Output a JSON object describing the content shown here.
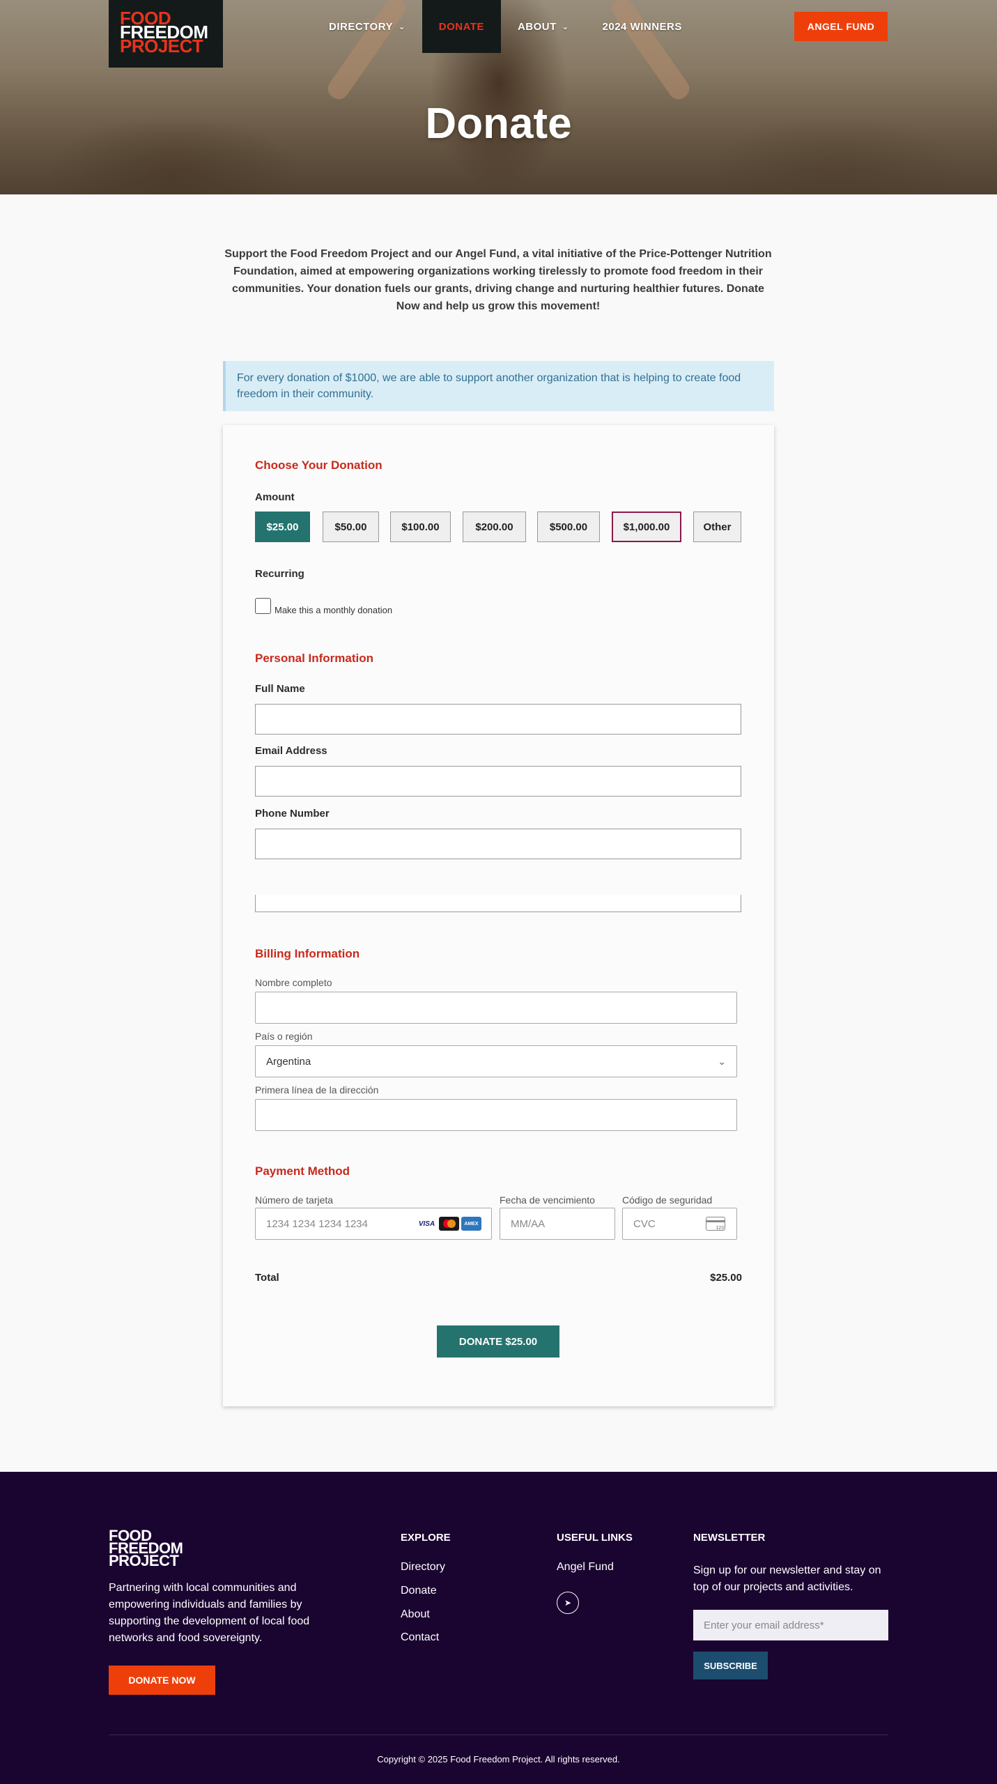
{
  "header": {
    "logo": [
      "FOOD",
      "FREEDOM",
      "PROJECT"
    ],
    "nav": [
      {
        "label": "DIRECTORY",
        "dropdown": true
      },
      {
        "label": "DONATE",
        "active": true
      },
      {
        "label": "ABOUT",
        "dropdown": true
      },
      {
        "label": "2024 WINNERS"
      }
    ],
    "cta": "ANGEL FUND",
    "page_title": "Donate"
  },
  "intro": "Support the Food Freedom Project and our Angel Fund, a vital initiative of the Price-Pottenger Nutrition Foundation, aimed at empowering organizations working tirelessly to promote food freedom in their communities. Your donation fuels our grants, driving change and nurturing healthier futures. Donate Now and help us grow this movement!",
  "notice": "For every donation of $1000, we are able to support another organization that is helping to create food freedom in their community.",
  "form": {
    "choose_title": "Choose Your Donation",
    "amount_label": "Amount",
    "amounts": [
      "$25.00",
      "$50.00",
      "$100.00",
      "$200.00",
      "$500.00",
      "$1,000.00",
      "Other"
    ],
    "selected_amount": "$25.00",
    "recurring_label": "Recurring",
    "recurring_checkbox": "Make this a monthly donation",
    "personal_title": "Personal Information",
    "full_name_label": "Full Name",
    "email_label": "Email Address",
    "phone_label": "Phone Number",
    "billing_title": "Billing Information",
    "billing_name_label": "Nombre completo",
    "country_label": "País o región",
    "country_value": "Argentina",
    "address_label": "Primera línea de la dirección",
    "payment_title": "Payment Method",
    "card_number_label": "Número de tarjeta",
    "card_number_placeholder": "1234 1234 1234 1234",
    "expiry_label": "Fecha de vencimiento",
    "expiry_placeholder": "MM/AA",
    "cvc_label": "Código de seguridad",
    "cvc_placeholder": "CVC",
    "card_brands": [
      "VISA",
      "mastercard",
      "AMEX"
    ],
    "total_label": "Total",
    "total_value": "$25.00",
    "submit": "DONATE $25.00"
  },
  "footer": {
    "logo": [
      "FOOD",
      "FREEDOM",
      "PROJECT"
    ],
    "description": "Partnering with local communities and empowering individuals and families by supporting the development of local food networks and food sovereignty.",
    "donate_now": "DONATE NOW",
    "explore_title": "EXPLORE",
    "explore_links": [
      "Directory",
      "Donate",
      "About",
      "Contact"
    ],
    "useful_title": "USEFUL LINKS",
    "useful_links": [
      "Angel Fund"
    ],
    "newsletter_title": "NEWSLETTER",
    "newsletter_text": "Sign up for our newsletter and stay on top of our projects and activities.",
    "email_placeholder": "Enter your email address*",
    "subscribe": "SUBSCRIBE",
    "copyright": "Copyright © 2025 Food Freedom Project. All rights reserved."
  },
  "colors": {
    "accent_orange": "#ee3f0b",
    "teal": "#24736e",
    "section_red": "#c8291b",
    "footer_bg": "#1a0430"
  }
}
